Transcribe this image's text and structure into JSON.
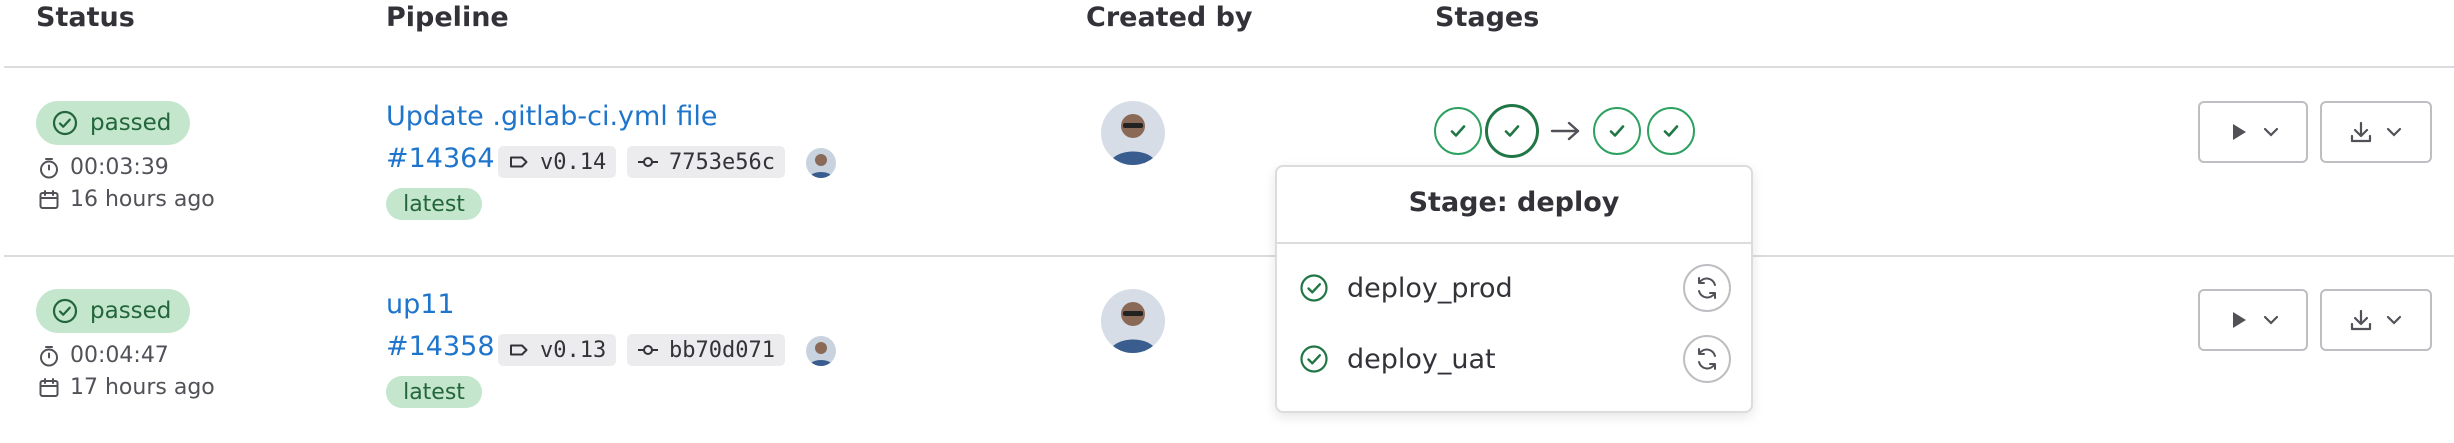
{
  "headers": {
    "status": "Status",
    "pipeline": "Pipeline",
    "created_by": "Created by",
    "stages": "Stages"
  },
  "colors": {
    "success": "#24663b",
    "success_bg": "#c3e6cd",
    "link": "#1f75cb",
    "border": "#dcdcde"
  },
  "icons": {
    "status": "check-circle-icon",
    "duration": "timer-icon",
    "created": "calendar-icon",
    "tag": "tag-icon",
    "commit": "commit-icon",
    "play": "play-icon",
    "download": "download-icon",
    "chevron": "chevron-down-icon",
    "retry": "retry-icon"
  },
  "rows": [
    {
      "status": "passed",
      "duration": "00:03:39",
      "created": "16 hours ago",
      "title": "Update .gitlab-ci.yml file",
      "id": "#14364",
      "tag": "v0.14",
      "commit": "7753e56c",
      "badge": "latest"
    },
    {
      "status": "passed",
      "duration": "00:04:47",
      "created": "17 hours ago",
      "title": "up11",
      "id": "#14358",
      "tag": "v0.13",
      "commit": "bb70d071",
      "badge": "latest"
    }
  ],
  "popover": {
    "title": "Stage: deploy",
    "jobs": [
      {
        "name": "deploy_prod"
      },
      {
        "name": "deploy_uat"
      }
    ]
  }
}
